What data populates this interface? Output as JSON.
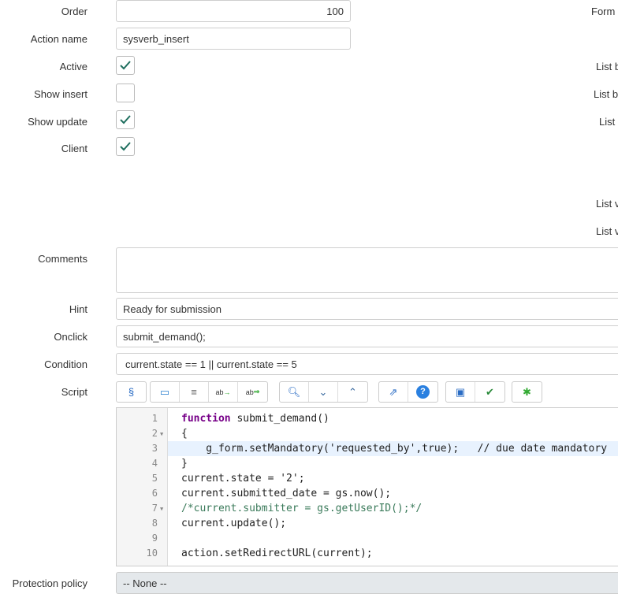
{
  "form": {
    "order": {
      "label": "Order",
      "value": "100"
    },
    "action_name": {
      "label": "Action name",
      "value": "sysverb_insert"
    },
    "active": {
      "label": "Active",
      "checked": true
    },
    "show_insert": {
      "label": "Show insert",
      "checked": false
    },
    "show_update": {
      "label": "Show update",
      "checked": true
    },
    "client": {
      "label": "Client",
      "checked": true
    },
    "comments": {
      "label": "Comments",
      "value": ""
    },
    "hint": {
      "label": "Hint",
      "value": "Ready for submission"
    },
    "onclick": {
      "label": "Onclick",
      "value": "submit_demand();"
    },
    "condition": {
      "label": "Condition",
      "value": "current.state == 1 || current.state == 5"
    },
    "script": {
      "label": "Script"
    },
    "protection_policy": {
      "label": "Protection policy",
      "value": "-- None --"
    }
  },
  "right_labels": [
    "Form",
    "List b",
    "List b",
    "List",
    "List v",
    "List v"
  ],
  "toolbar": [
    "format-code",
    "comment",
    "align",
    "replace",
    "replace-all",
    "search",
    "next",
    "previous",
    "fullscreen",
    "help",
    "save",
    "check-syntax",
    "debug"
  ],
  "code_lines": [
    {
      "n": "1",
      "t": "function submit_demand()"
    },
    {
      "n": "2",
      "t": "{"
    },
    {
      "n": "3",
      "t": "    g_form.setMandatory('requested_by',true);   // due date mandatory"
    },
    {
      "n": "4",
      "t": "}"
    },
    {
      "n": "5",
      "t": "current.state = '2';"
    },
    {
      "n": "6",
      "t": "current.submitted_date = gs.now();"
    },
    {
      "n": "7",
      "t": "/*current.submitter = gs.getUserID();*/"
    },
    {
      "n": "8",
      "t": "current.update();"
    },
    {
      "n": "9",
      "t": ""
    },
    {
      "n": "10",
      "t": "action.setRedirectURL(current);"
    }
  ],
  "colors": {
    "check": "#1f6f5f",
    "highlight": "#e8f2fe",
    "keyword": "#770088",
    "string": "#1111aa",
    "comment": "#3a7a5a"
  }
}
